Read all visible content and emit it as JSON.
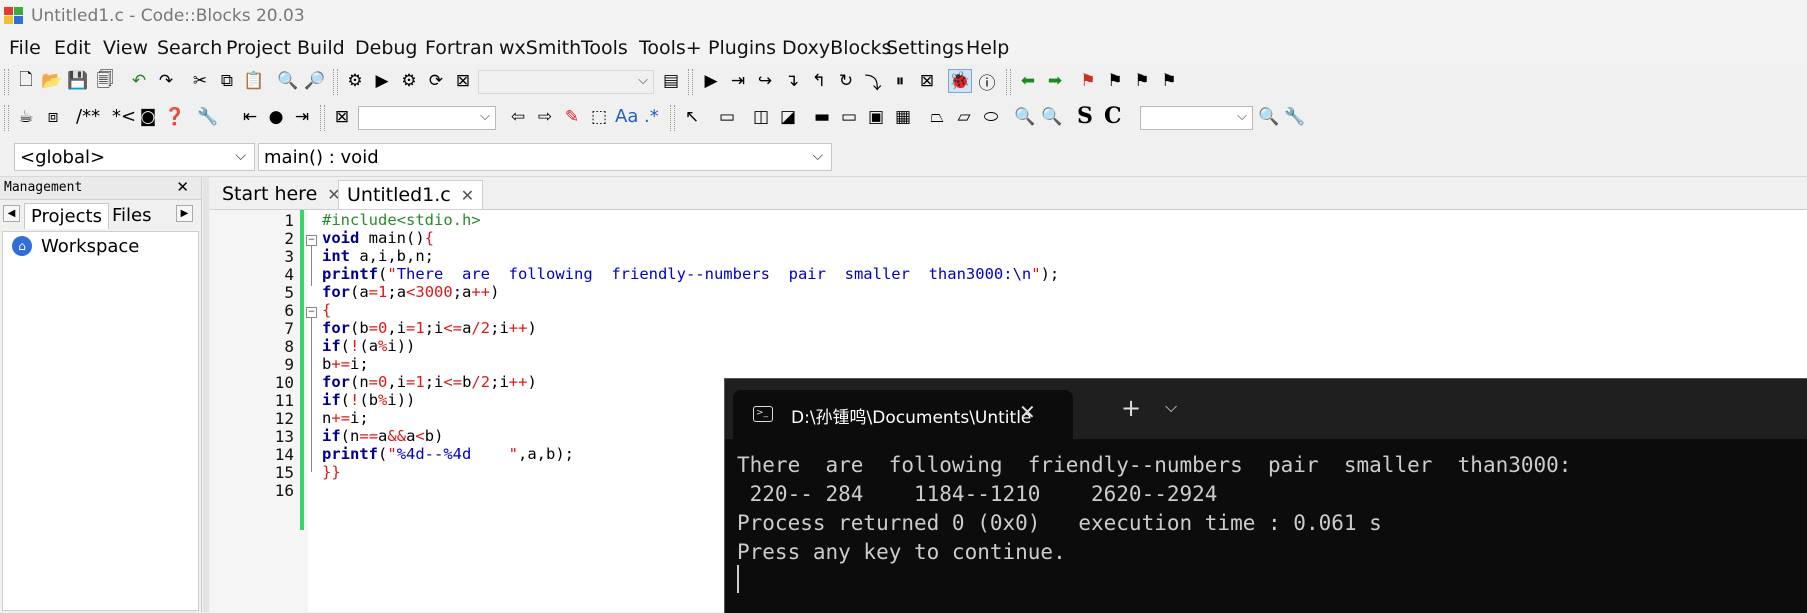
{
  "window": {
    "title": "Untitled1.c - Code::Blocks 20.03"
  },
  "menu": [
    "File",
    "Edit",
    "View",
    "Search",
    "Project",
    "Build",
    "Debug",
    "Fortran",
    "wxSmith",
    "Tools",
    "Tools+",
    "Plugins",
    "DoxyBlocks",
    "Settings",
    "Help"
  ],
  "toolbar": {
    "doc_comment": "/**",
    "line_comment": "*<",
    "strong_label": "S",
    "case_label": "C",
    "regex_label": ".*",
    "font_label": "Aa"
  },
  "scope": {
    "global": "<global>",
    "function": "main() : void"
  },
  "management": {
    "title": "Management",
    "tabs": [
      "Projects",
      "Files"
    ],
    "workspace": "Workspace"
  },
  "editor": {
    "tabs": [
      "Start here",
      "Untitled1.c"
    ],
    "line_numbers": [
      "1",
      "2",
      "3",
      "4",
      "5",
      "6",
      "7",
      "8",
      "9",
      "10",
      "11",
      "12",
      "13",
      "14",
      "15",
      "16"
    ],
    "lines": [
      "#include<stdio.h>",
      "void main(){",
      "int a,i,b,n;",
      "printf(\"There  are  following  friendly--numbers  pair  smaller  than3000:\\n\");",
      "for(a=1;a<3000;a++)",
      "{",
      "for(b=0,i=1;i<=a/2;i++)",
      "if(!(a%i))",
      "b+=i;",
      "for(n=0,i=1;i<=b/2;i++)",
      "if(!(b%i))",
      "n+=i;",
      "if(n==a&&a<b)",
      "printf(\"%4d--%4d    \",a,b);",
      "}}",
      ""
    ]
  },
  "terminal": {
    "tab_title": "D:\\孙锺鸣\\Documents\\Untitle",
    "lines": [
      "There  are  following  friendly--numbers  pair  smaller  than3000:",
      " 220-- 284    1184--1210    2620--2924",
      "Process returned 0 (0x0)   execution time : 0.061 s",
      "Press any key to continue."
    ]
  },
  "colors": {
    "keyword": "#00008b",
    "preprocessor": "#2a8a2a",
    "operator": "#e01818",
    "string": "#0000cc",
    "terminal_bg": "#0c0c0c"
  }
}
